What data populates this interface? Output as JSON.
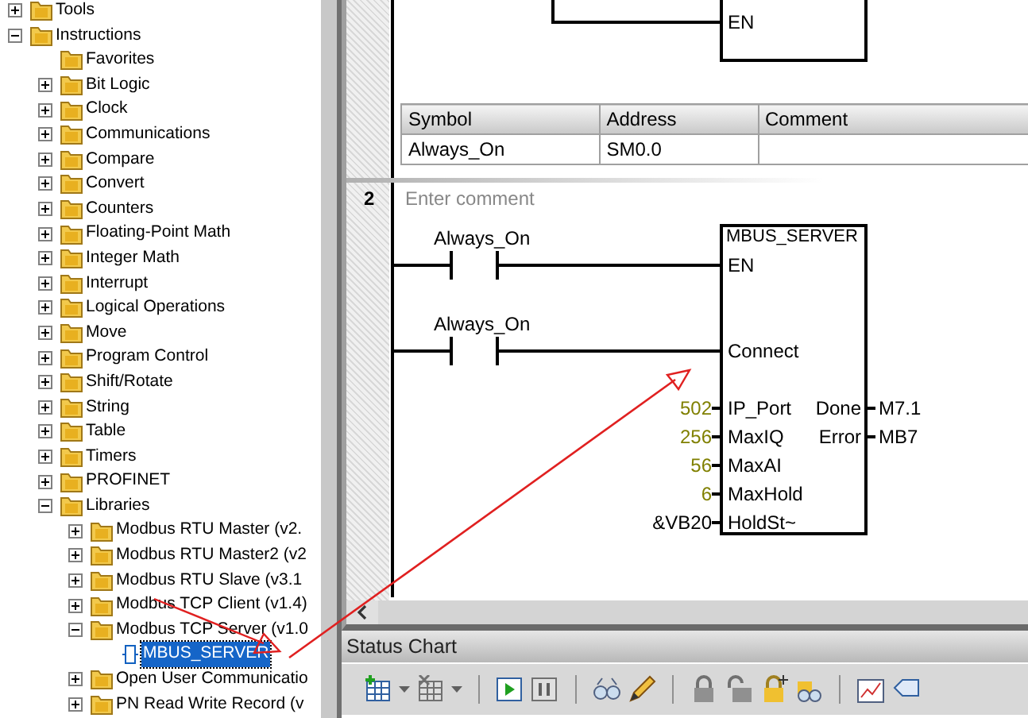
{
  "tree": [
    {
      "label": "Tools",
      "kind": "folder",
      "expanded": false,
      "selected": false
    },
    {
      "label": "Instructions",
      "kind": "folder",
      "expanded": true,
      "selected": false,
      "children": [
        {
          "label": "Favorites",
          "kind": "folder",
          "selected": false
        },
        {
          "label": "Bit Logic",
          "kind": "folder",
          "expanded": false,
          "selected": false
        },
        {
          "label": "Clock",
          "kind": "folder",
          "expanded": false,
          "selected": false
        },
        {
          "label": "Communications",
          "kind": "folder",
          "expanded": false,
          "selected": false
        },
        {
          "label": "Compare",
          "kind": "folder",
          "expanded": false,
          "selected": false
        },
        {
          "label": "Convert",
          "kind": "folder",
          "expanded": false,
          "selected": false
        },
        {
          "label": "Counters",
          "kind": "folder",
          "expanded": false,
          "selected": false
        },
        {
          "label": "Floating-Point Math",
          "kind": "folder",
          "expanded": false,
          "selected": false
        },
        {
          "label": "Integer Math",
          "kind": "folder",
          "expanded": false,
          "selected": false
        },
        {
          "label": "Interrupt",
          "kind": "folder",
          "expanded": false,
          "selected": false
        },
        {
          "label": "Logical Operations",
          "kind": "folder",
          "expanded": false,
          "selected": false
        },
        {
          "label": "Move",
          "kind": "folder",
          "expanded": false,
          "selected": false
        },
        {
          "label": "Program Control",
          "kind": "folder",
          "expanded": false,
          "selected": false
        },
        {
          "label": "Shift/Rotate",
          "kind": "folder",
          "expanded": false,
          "selected": false
        },
        {
          "label": "String",
          "kind": "folder",
          "expanded": false,
          "selected": false
        },
        {
          "label": "Table",
          "kind": "folder",
          "expanded": false,
          "selected": false
        },
        {
          "label": "Timers",
          "kind": "folder",
          "expanded": false,
          "selected": false
        },
        {
          "label": "PROFINET",
          "kind": "folder",
          "expanded": false,
          "selected": false
        },
        {
          "label": "Libraries",
          "kind": "folder",
          "expanded": true,
          "selected": false,
          "children": [
            {
              "label": "Modbus RTU Master (v2.",
              "kind": "folder",
              "expanded": false,
              "selected": false
            },
            {
              "label": "Modbus RTU Master2 (v2",
              "kind": "folder",
              "expanded": false,
              "selected": false
            },
            {
              "label": "Modbus RTU Slave (v3.1",
              "kind": "folder",
              "expanded": false,
              "selected": false
            },
            {
              "label": "Modbus TCP Client (v1.4)",
              "kind": "folder",
              "expanded": false,
              "selected": false
            },
            {
              "label": "Modbus TCP Server (v1.0",
              "kind": "folder",
              "expanded": true,
              "selected": false,
              "children": [
                {
                  "label": "MBUS_SERVER",
                  "kind": "block",
                  "selected": true
                }
              ]
            },
            {
              "label": "Open User Communicatio",
              "kind": "folder",
              "expanded": false,
              "selected": false
            },
            {
              "label": "PN Read Write Record (v",
              "kind": "folder",
              "expanded": false,
              "selected": false
            }
          ]
        }
      ]
    }
  ],
  "network_1": {
    "box_pin": "EN",
    "symbols": {
      "columns": [
        "Symbol",
        "Address",
        "Comment"
      ],
      "rows": [
        [
          "Always_On",
          "SM0.0"
        ]
      ]
    }
  },
  "network_2": {
    "number": "2",
    "comment_placeholder": "Enter comment",
    "box_title": "MBUS_SERVER",
    "contacts": [
      {
        "label": "Always_On",
        "pin": "EN"
      },
      {
        "label": "Always_On",
        "pin": "Connect"
      }
    ],
    "inputs": [
      {
        "value": "502",
        "color": "#808000",
        "pin": "IP_Port"
      },
      {
        "value": "256",
        "color": "#808000",
        "pin": "MaxIQ"
      },
      {
        "value": "56",
        "color": "#808000",
        "pin": "MaxAI"
      },
      {
        "value": "6",
        "color": "#808000",
        "pin": "MaxHold"
      },
      {
        "value": "&VB20",
        "color": "#000000",
        "pin": "HoldSt~"
      }
    ],
    "outputs": [
      {
        "pin": "Done",
        "value": "M7.1"
      },
      {
        "pin": "Error",
        "value": "MB7"
      }
    ]
  },
  "status_chart": {
    "title": "Status Chart"
  }
}
